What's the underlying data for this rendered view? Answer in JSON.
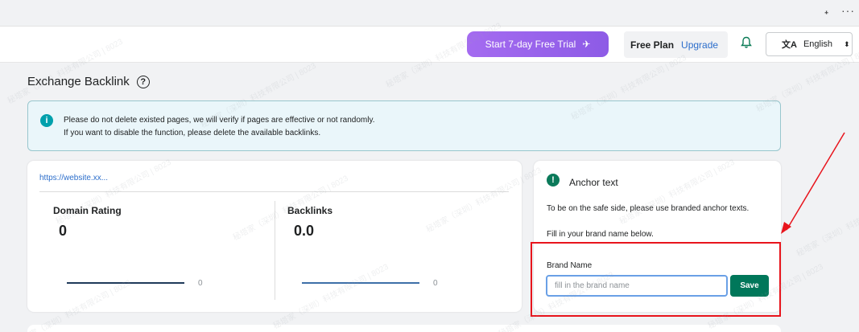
{
  "browser": {
    "pin_icon": "pin-icon",
    "menu_icon": "more-dots-icon"
  },
  "header": {
    "trial_button": "Start 7-day Free Trial",
    "plan_label": "Free Plan",
    "upgrade_link": "Upgrade",
    "bell_icon": "bell-icon",
    "language": "English"
  },
  "page": {
    "title": "Exchange Backlink",
    "help_icon": "question-circle-icon"
  },
  "banner": {
    "line1": "Please do not delete existed pages, we will verify if pages are effective or not randomly.",
    "line2": "If you want to disable the function, please delete the available backlinks."
  },
  "stats": {
    "site_url": "https://website.xx...",
    "domain_rating": {
      "label": "Domain Rating",
      "value": "0",
      "spark_end": "0"
    },
    "backlinks": {
      "label": "Backlinks",
      "value": "0.0",
      "spark_end": "0"
    }
  },
  "anchor": {
    "title": "Anchor text",
    "p1": "To be on the safe side, please use branded anchor texts.",
    "p2": "Fill in your brand name below.",
    "brand_label": "Brand Name",
    "brand_placeholder": "fill in the brand name",
    "save_label": "Save"
  },
  "colors": {
    "accent_green": "#00775a",
    "trial_purple": "#9a63ec",
    "annotation_red": "#e8141c",
    "link_blue": "#2c6ecb"
  },
  "watermark": "秘塔家（深圳）科技有限公司 | 8023"
}
